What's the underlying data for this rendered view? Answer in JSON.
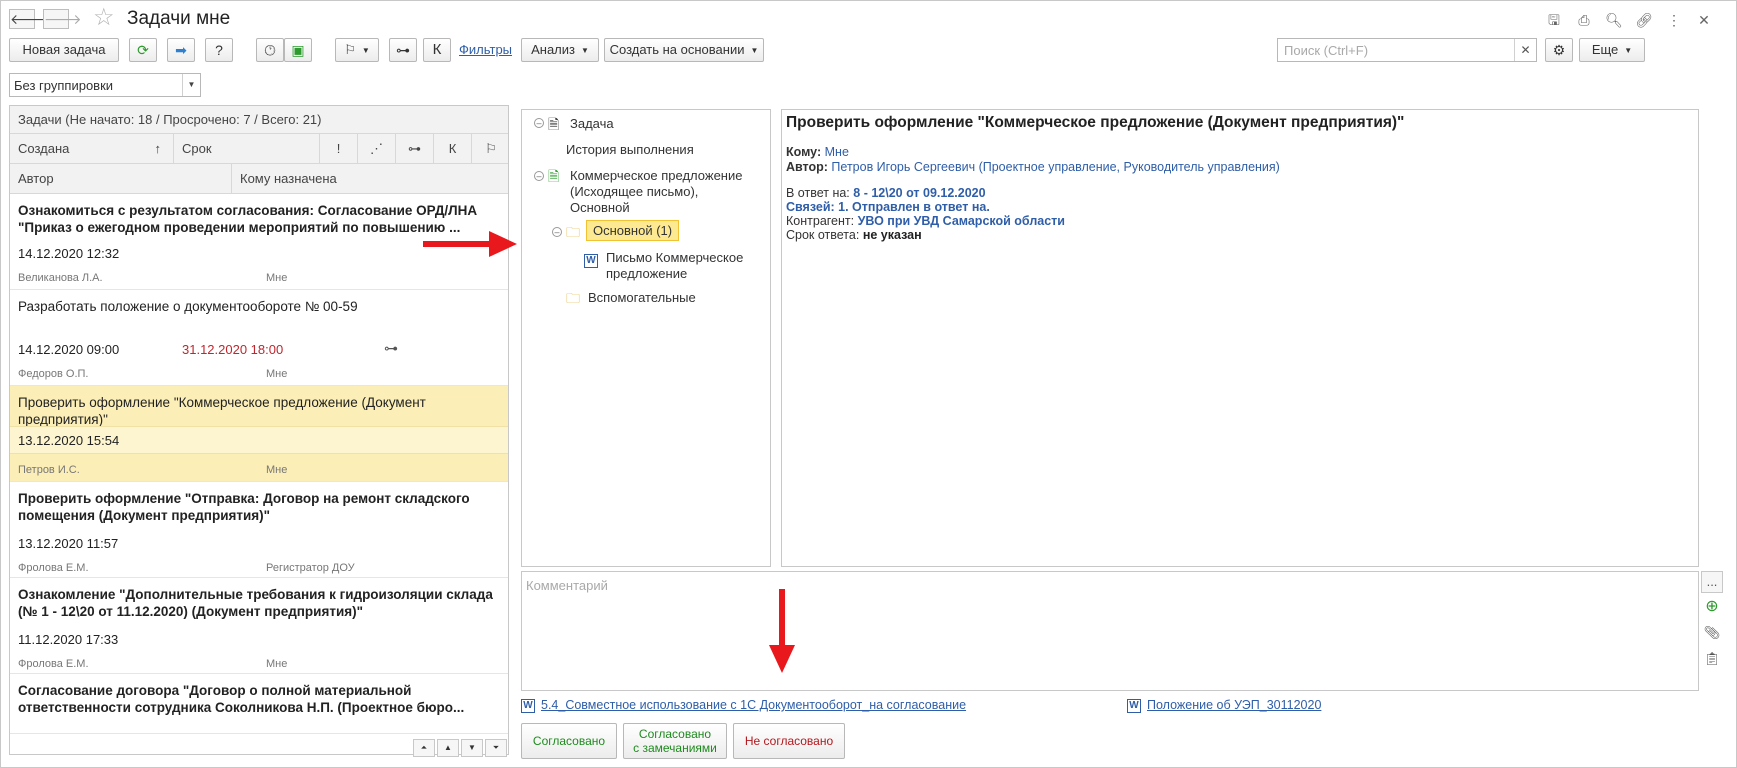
{
  "window": {
    "title": "Задачи мне"
  },
  "titlebar_icons": [
    "save-icon",
    "print-icon",
    "preview-icon",
    "link-icon",
    "more-vertical-icon",
    "close-icon"
  ],
  "toolbar": {
    "new_task": "Новая задача",
    "k_label": "К",
    "filters_link": "Фильтры",
    "analysis": "Анализ",
    "create_based": "Создать на основании",
    "search_placeholder": "Поиск (Ctrl+F)",
    "more": "Еще"
  },
  "grouping": {
    "value": "Без группировки"
  },
  "list": {
    "summary": "Задачи (Не начато: 18 / Просрочено: 7 / Всего: 21)",
    "headers": {
      "created": "Создана",
      "sort_arrow": "↑",
      "due": "Срок",
      "author": "Автор",
      "assigned": "Кому назначена",
      "k": "К"
    },
    "items": [
      {
        "title": "Ознакомиться с результатом согласования: Согласование ОРД/ЛНА \"Приказ о ежегодном проведении мероприятий по повышению ...",
        "created": "14.12.2020 12:32",
        "due": "",
        "author": "Великанова Л.А.",
        "assigned": "Мне",
        "bold": true
      },
      {
        "title": "Разработать положение о документообороте №  00-59",
        "created": "14.12.2020 09:00",
        "due": "31.12.2020 18:00",
        "author": "Федоров О.П.",
        "assigned": "Мне",
        "bold": false
      },
      {
        "title": "Проверить оформление \"Коммерческое предложение (Документ предприятия)\"",
        "created": "13.12.2020 15:54",
        "due": "",
        "author": "Петров И.С.",
        "assigned": "Мне",
        "bold": false
      },
      {
        "title": "Проверить оформление \"Отправка: Договор на ремонт складского помещения (Документ предприятия)\"",
        "created": "13.12.2020 11:57",
        "due": "",
        "author": "Фролова Е.М.",
        "assigned": "Регистратор ДОУ",
        "bold": true
      },
      {
        "title": "Ознакомление \"Дополнительные требования к гидроизоляции склада (№ 1 - 12\\20 от 11.12.2020) (Документ предприятия)\"",
        "created": "11.12.2020 17:33",
        "due": "",
        "author": "Фролова Е.М.",
        "assigned": "Мне",
        "bold": true
      },
      {
        "title": "Согласование договора \"Договор о полной материальной ответственности сотрудника Соколникова Н.П. (Проектное бюро...",
        "created": "",
        "due": "",
        "author": "",
        "assigned": "",
        "bold": false
      }
    ]
  },
  "tree": {
    "task": "Задача",
    "history": "История выполнения",
    "doc_line1": "Коммерческое предложение",
    "doc_line2": "(Исходящее письмо),",
    "doc_line3": "Основной",
    "main_folder": "Основной (1)",
    "file_line1": "Письмо Коммерческое",
    "file_line2": "предложение",
    "aux_folder": "Вспомогательные"
  },
  "detail": {
    "heading": "Проверить оформление \"Коммерческое предложение (Документ предприятия)\"",
    "to_label": "Кому:",
    "to_value": "Мне",
    "author_label": "Автор:",
    "author_value": "Петров Игорь Сергеевич (Проектное управление, Руководитель управления)",
    "reply_label": "В ответ на:",
    "reply_value": "8 - 12\\20 от 09.12.2020",
    "links_label": "Связей: 1. Отправлен в ответ на.",
    "contractor_label": "Контрагент:",
    "contractor_value": "УВО при УВД Самарской области",
    "deadline_label": "Срок ответа:",
    "deadline_value": "не указан"
  },
  "comment": {
    "placeholder": "Комментарий",
    "more": "..."
  },
  "attachments": [
    "5.4_Совместное использование с 1С Документооборот_на согласование",
    "Положение об УЭП_30112020"
  ],
  "actions": {
    "approved": "Согласовано",
    "approved_remarks_1": "Согласовано",
    "approved_remarks_2": "с замечаниями",
    "not_approved": "Не согласовано"
  },
  "colors": {
    "approved": "#1e8a1e",
    "not_approved": "#b3171d",
    "selection": "#fbeeb6",
    "link": "#2f5ea8",
    "overdue": "#c0262d",
    "arrow": "#e8181c"
  }
}
